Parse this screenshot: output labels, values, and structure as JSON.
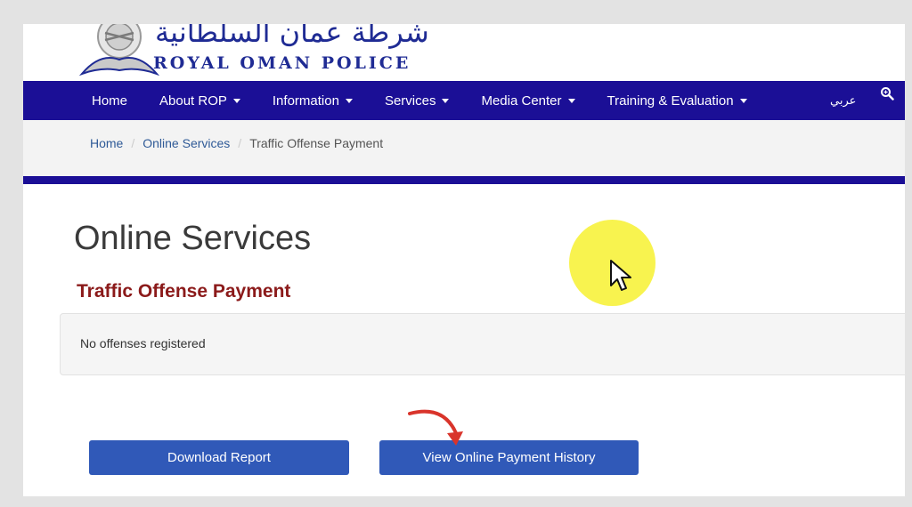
{
  "header": {
    "logo_arabic": "شرطة عمان السلطانية",
    "logo_english": "ROYAL OMAN POLICE"
  },
  "nav": {
    "items": [
      {
        "label": "Home",
        "dropdown": false
      },
      {
        "label": "About ROP",
        "dropdown": true
      },
      {
        "label": "Information",
        "dropdown": true
      },
      {
        "label": "Services",
        "dropdown": true
      },
      {
        "label": "Media Center",
        "dropdown": true
      },
      {
        "label": "Training & Evaluation",
        "dropdown": true
      }
    ],
    "language": "عربي",
    "search_icon": "search-icon"
  },
  "breadcrumb": {
    "home": "Home",
    "online_services": "Online Services",
    "current": "Traffic Offense Payment"
  },
  "main": {
    "title": "Online Services",
    "subtitle": "Traffic Offense Payment",
    "message": "No offenses registered"
  },
  "buttons": {
    "download_report": "Download Report",
    "payment_history": "View Online Payment History"
  },
  "colors": {
    "nav_bg": "#1b0f96",
    "button_bg": "#3059b8",
    "subtitle": "#8b1a1a",
    "highlight": "#f7f23c",
    "annotation_arrow": "#d9342b"
  }
}
